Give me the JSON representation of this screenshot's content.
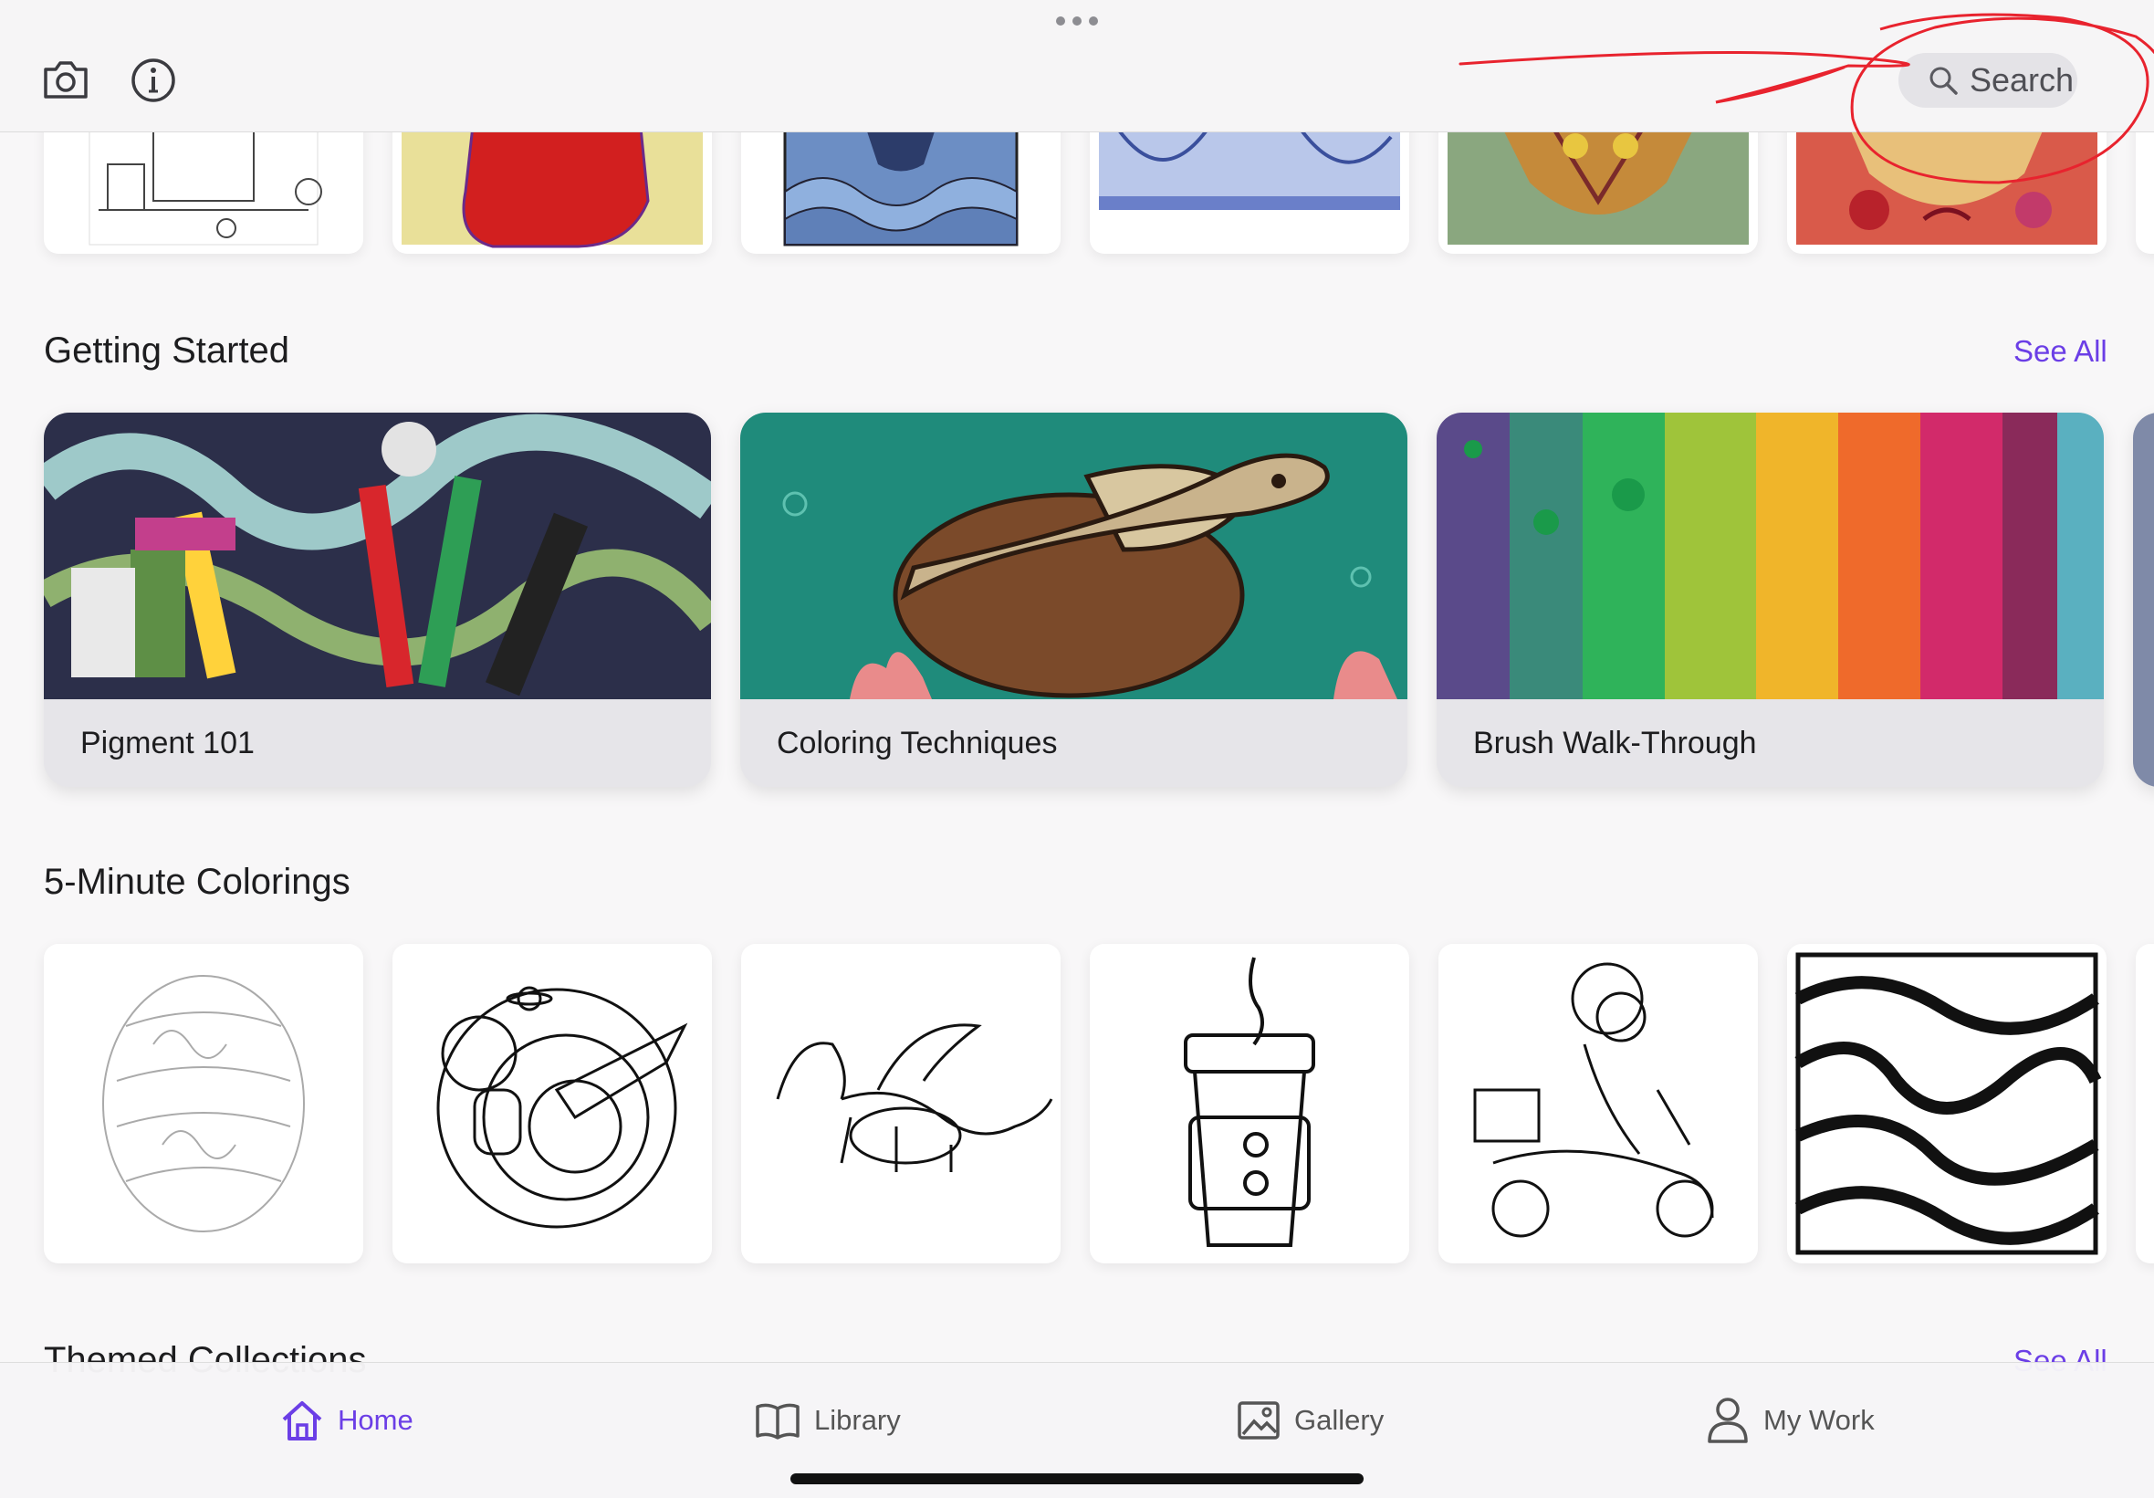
{
  "topbar": {
    "search_label": "Search"
  },
  "sections": {
    "getting_started": {
      "title": "Getting Started",
      "see_all": "See All",
      "cards": [
        {
          "label": "Pigment 101"
        },
        {
          "label": "Coloring Techniques"
        },
        {
          "label": "Brush Walk-Through"
        }
      ]
    },
    "five_minute": {
      "title": "5-Minute Colorings"
    },
    "themed": {
      "title": "Themed Collections",
      "see_all": "See All"
    }
  },
  "tabbar": {
    "tabs": [
      {
        "label": "Home",
        "icon": "home-icon",
        "active": true
      },
      {
        "label": "Library",
        "icon": "book-icon",
        "active": false
      },
      {
        "label": "Gallery",
        "icon": "image-icon",
        "active": false
      },
      {
        "label": "My Work",
        "icon": "person-icon",
        "active": false
      }
    ]
  },
  "colors": {
    "accent": "#6b3ee6",
    "annotation": "#e8232e"
  }
}
